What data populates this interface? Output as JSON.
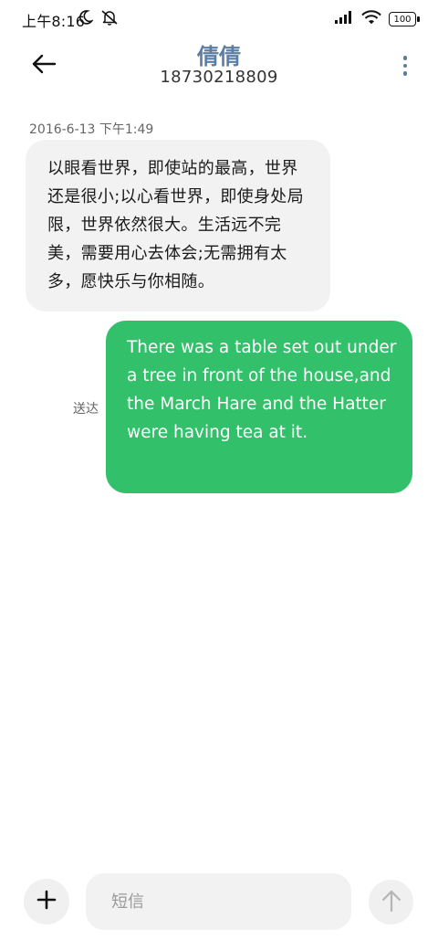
{
  "status_bar": {
    "time": "上午8:16",
    "battery": "100",
    "icons": [
      "moon-icon",
      "mute-icon",
      "signal-icon",
      "wifi-icon",
      "battery-icon"
    ]
  },
  "header": {
    "contact_name": "倩倩",
    "contact_number": "18730218809",
    "accent_color": "#5a7ea3"
  },
  "conversation": {
    "messages": [
      {
        "direction": "incoming",
        "timestamp": "2016-6-13 下午1:49",
        "text": "以眼看世界，即使站的最高，世界还是很小;以心看世界，即使身处局限，世界依然很大。生活远不完美，需要用心去体会;无需拥有太多，愿快乐与你相随。"
      },
      {
        "direction": "outgoing",
        "status": "送达",
        "text": "There was a table set out under a tree in front of the house,and the March Hare and the Hatter were having tea at it.",
        "bubble_color": "#33c06b"
      }
    ]
  },
  "composer": {
    "placeholder": "短信",
    "value": ""
  }
}
